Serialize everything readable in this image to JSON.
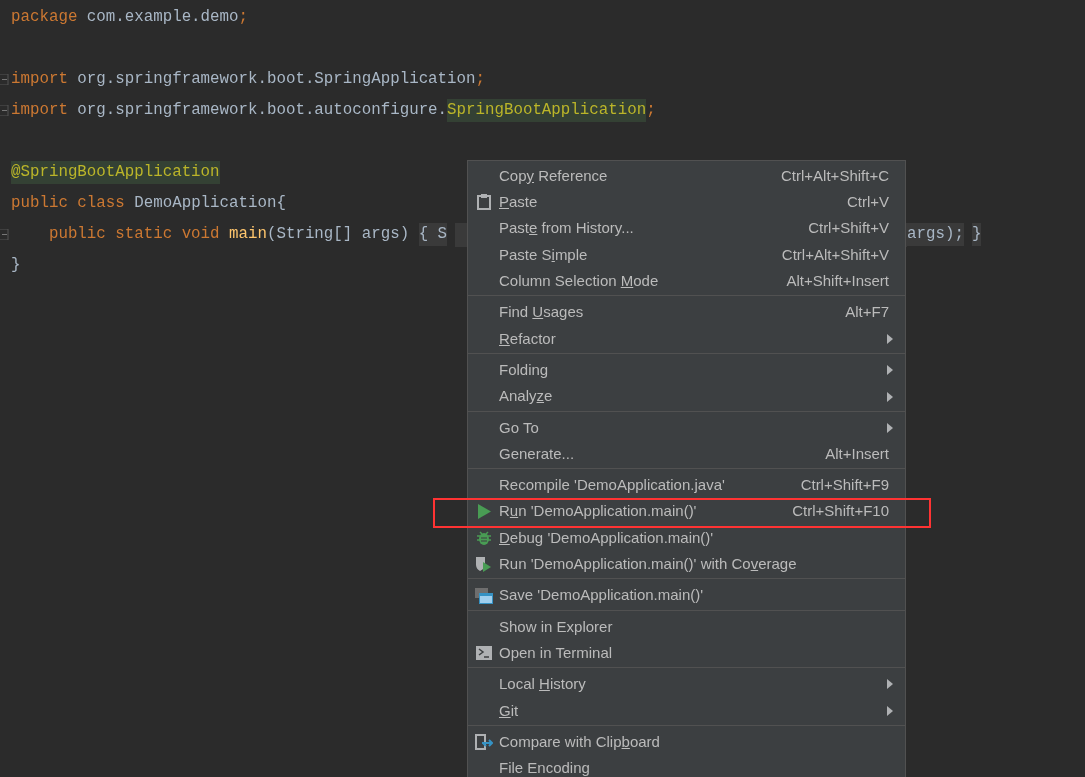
{
  "editor": {
    "blocks": [
      [
        {
          "tokens": [
            {
              "kind": "keyword",
              "text": "package"
            },
            {
              "kind": "plain",
              "text": " com.example.demo"
            },
            {
              "kind": "keyword",
              "text": ";"
            }
          ]
        }
      ],
      [
        {
          "fold": true,
          "tokens": [
            {
              "kind": "keyword",
              "text": "import"
            },
            {
              "kind": "plain",
              "text": " org.springframework.boot.SpringApplication"
            },
            {
              "kind": "keyword",
              "text": ";"
            }
          ]
        },
        {
          "fold": true,
          "tokens": [
            {
              "kind": "keyword",
              "text": "import"
            },
            {
              "kind": "plain",
              "text": " org.springframework.boot.autoconfigure."
            },
            {
              "kind": "usage",
              "text": "SpringBootApplication"
            },
            {
              "kind": "keyword",
              "text": ";"
            }
          ]
        }
      ],
      [
        {
          "tokens": [
            {
              "kind": "annotation",
              "text": "@SpringBootApplication"
            }
          ]
        },
        {
          "tokens": [
            {
              "kind": "keyword",
              "text": "public class "
            },
            {
              "kind": "plain",
              "text": "DemoApplication{"
            }
          ]
        },
        {
          "fold": true,
          "tokens": [
            {
              "kind": "keyword",
              "text": "    public static void "
            },
            {
              "kind": "method",
              "text": "main"
            },
            {
              "kind": "plain",
              "text": "(String[] args) "
            },
            {
              "kind": "folded",
              "text": "{ S"
            },
            {
              "kind": "gap"
            },
            {
              "kind": "folded",
              "text": "args);"
            },
            {
              "kind": "folded",
              "text": "}"
            }
          ]
        },
        {
          "tokens": [
            {
              "kind": "plain",
              "text": "}"
            }
          ]
        }
      ]
    ]
  },
  "context_menu": {
    "groups": [
      [
        {
          "kind": "text",
          "before": "Cop",
          "key": "y",
          "after": " Reference",
          "shortcut": "Ctrl+Alt+Shift+C"
        },
        {
          "kind": "paste",
          "key": "P",
          "after": "aste",
          "shortcut": "Ctrl+V"
        },
        {
          "kind": "text",
          "before": "Past",
          "key": "e",
          "after": " from History...",
          "shortcut": "Ctrl+Shift+V"
        },
        {
          "kind": "text",
          "before": "Paste S",
          "key": "i",
          "after": "mple",
          "shortcut": "Ctrl+Alt+Shift+V"
        },
        {
          "kind": "text",
          "before": "Column Selection ",
          "key": "M",
          "after": "ode",
          "shortcut": "Alt+Shift+Insert"
        }
      ],
      [
        {
          "kind": "text",
          "before": "Find ",
          "key": "U",
          "after": "sages",
          "shortcut": "Alt+F7"
        },
        {
          "kind": "text",
          "key": "R",
          "after": "efactor",
          "submenu": true
        }
      ],
      [
        {
          "kind": "text",
          "before": "Folding",
          "submenu": true
        },
        {
          "kind": "text",
          "before": "Analy",
          "key": "z",
          "after": "e",
          "submenu": true
        }
      ],
      [
        {
          "kind": "text",
          "before": "Go To",
          "submenu": true
        },
        {
          "kind": "text",
          "before": "Generate...",
          "shortcut": "Alt+Insert"
        }
      ],
      [
        {
          "kind": "text",
          "before": "Recompile 'DemoApplication.java'",
          "shortcut": "Ctrl+Shift+F9"
        },
        {
          "kind": "run",
          "before": "R",
          "key": "u",
          "after": "n 'DemoApplication.main()'",
          "shortcut": "Ctrl+Shift+F10",
          "annotated": true
        },
        {
          "kind": "debug",
          "key": "D",
          "after": "ebug 'DemoApplication.main()'"
        },
        {
          "kind": "coverage",
          "before": "Run 'DemoApplication.main()' with Co",
          "key": "v",
          "after": "erage"
        }
      ],
      [
        {
          "kind": "save",
          "before": "Save 'DemoApplication.main()'"
        }
      ],
      [
        {
          "kind": "text",
          "before": "Show in Explorer"
        },
        {
          "kind": "terminal",
          "before": "Open in Terminal"
        }
      ],
      [
        {
          "kind": "text",
          "before": "Local ",
          "key": "H",
          "after": "istory",
          "submenu": true
        },
        {
          "kind": "text",
          "key": "G",
          "after": "it",
          "submenu": true
        }
      ],
      [
        {
          "kind": "compare",
          "before": "Compare with Clip",
          "key": "b",
          "after": "oard"
        },
        {
          "kind": "text",
          "before": "File Encoding"
        }
      ]
    ]
  }
}
